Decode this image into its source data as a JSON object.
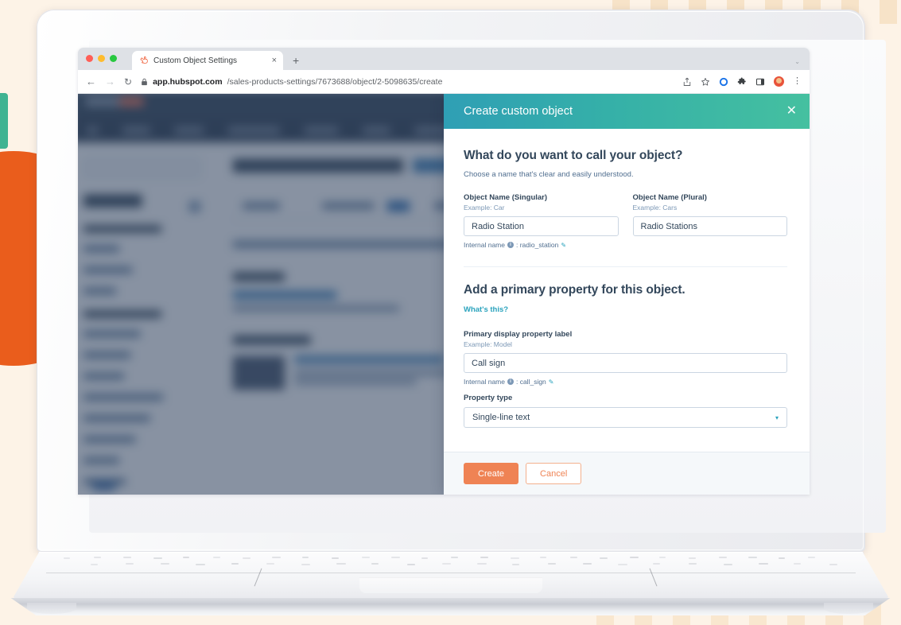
{
  "browser": {
    "tab": {
      "title": "Custom Object Settings",
      "close_label": "×",
      "favicon": "hubspot-sprocket-icon"
    },
    "new_tab_label": "+",
    "tabstrip_chevron": "⌄",
    "nav": {
      "back": "←",
      "forward": "→",
      "reload": "↻"
    },
    "url": {
      "lock": "🔒",
      "host": "app.hubspot.com",
      "path": "/sales-products-settings/7673688/object/2-5098635/create"
    },
    "toolbar_icons": [
      "share-icon",
      "bookmark-star-icon",
      "blue-circle-icon",
      "extensions-puzzle-icon",
      "side-panel-icon",
      "profile-avatar-icon"
    ],
    "menu_label": "⋮"
  },
  "modal": {
    "title": "Create custom object",
    "close_label": "✕",
    "section1": {
      "heading": "What do you want to call your object?",
      "helper": "Choose a name that's clear and easily understood."
    },
    "singular": {
      "label": "Object Name (Singular)",
      "example": "Example: Car",
      "value": "Radio Station",
      "internal_prefix": "Internal name",
      "internal_info": "i",
      "internal_value": ": radio_station",
      "edit_icon": "✎"
    },
    "plural": {
      "label": "Object Name (Plural)",
      "example": "Example: Cars",
      "value": "Radio Stations"
    },
    "section2": {
      "heading": "Add a primary property for this object.",
      "link": "What's this?"
    },
    "primary_property": {
      "label": "Primary display property label",
      "example": "Example: Model",
      "value": "Call sign",
      "internal_prefix": "Internal name",
      "internal_info": "i",
      "internal_value": ": call_sign",
      "edit_icon": "✎"
    },
    "property_type": {
      "label": "Property type",
      "value": "Single-line text",
      "caret": "▾"
    },
    "footer": {
      "create_label": "Create",
      "cancel_label": "Cancel"
    }
  },
  "colors": {
    "modal_header_start": "#2f9fb5",
    "modal_header_end": "#45c0a0",
    "primary_button": "#ef8354",
    "link": "#2aa3bd",
    "page_background": "#fdf3e7",
    "accent_orange": "#ea5d1c",
    "accent_teal": "#3fb392"
  }
}
